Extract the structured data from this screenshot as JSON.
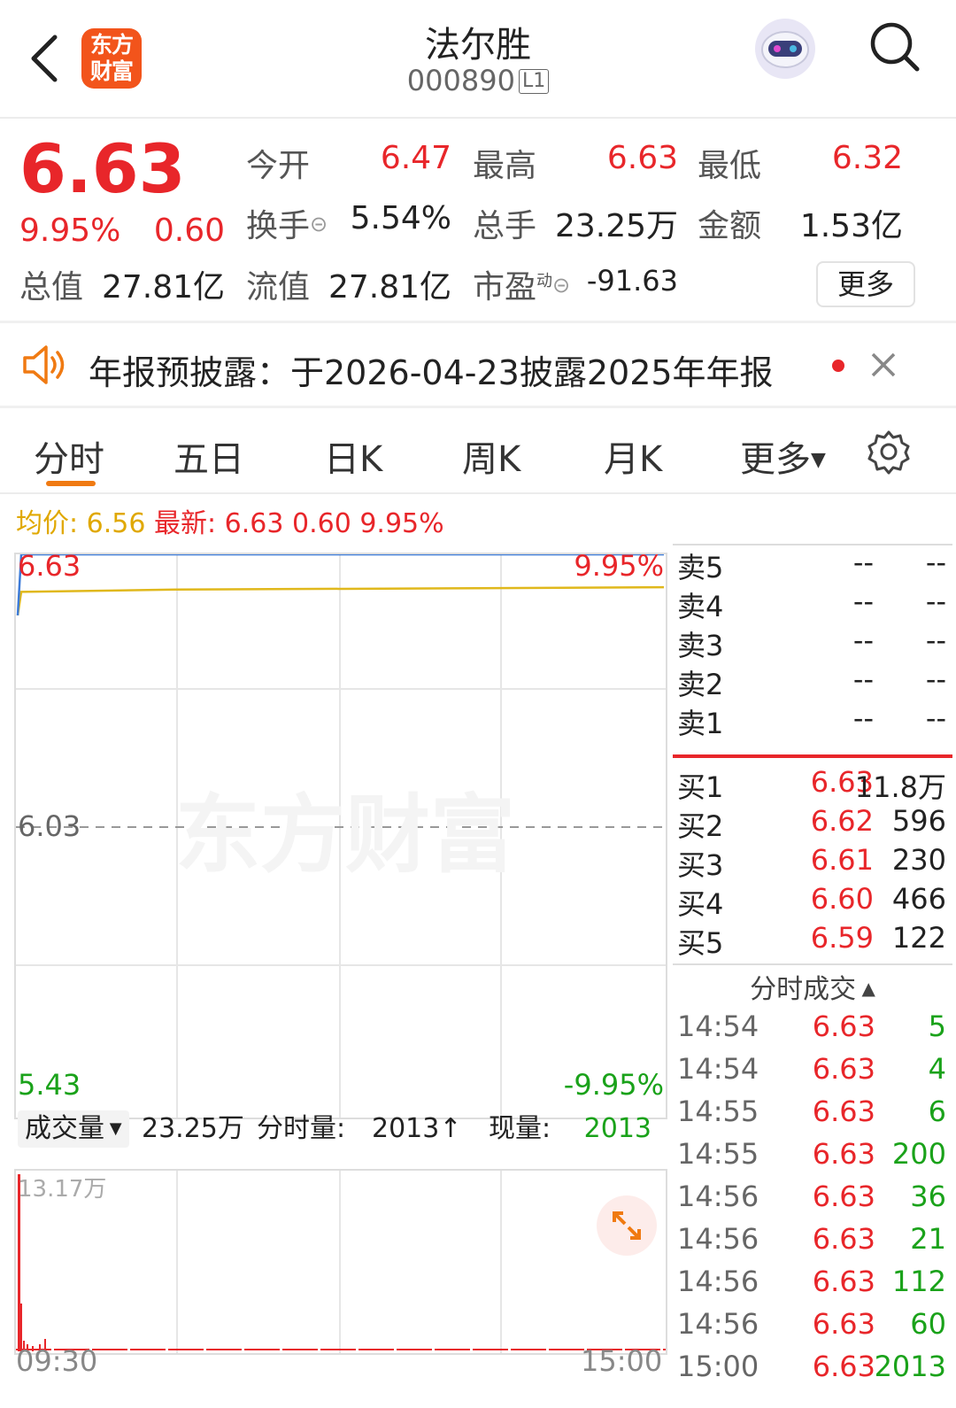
{
  "header": {
    "logo_line1": "东方",
    "logo_line2": "财富",
    "title": "法尔胜",
    "code": "000890",
    "level": "L1"
  },
  "quote": {
    "price": "6.63",
    "change_pct": "9.95%",
    "change": "0.60",
    "open_label": "今开",
    "open": "6.47",
    "high_label": "最高",
    "high": "6.63",
    "low_label": "最低",
    "low": "6.32",
    "turnover_label": "换手",
    "turnover": "5.54%",
    "volume_label": "总手",
    "volume": "23.25万",
    "amount_label": "金额",
    "amount": "1.53亿",
    "mktcap_label": "总值",
    "mktcap": "27.81亿",
    "float_label": "流值",
    "float": "27.81亿",
    "pe_label": "市盈",
    "pe_sup": "动",
    "pe": "-91.63",
    "more": "更多"
  },
  "notice": {
    "text": "年报预披露：于2026-04-23披露2025年年报"
  },
  "tabs": [
    "分时",
    "五日",
    "日K",
    "周K",
    "月K",
    "更多"
  ],
  "legend": {
    "avg_label": "均价:",
    "avg": "6.56",
    "last_label": "最新:",
    "last": "6.63",
    "chg": "0.60",
    "pct": "9.95%"
  },
  "chart": {
    "top_price": "6.63",
    "top_pct": "9.95%",
    "mid_price": "6.03",
    "bottom_price": "5.43",
    "bottom_pct": "-9.95%",
    "watermark": "东方财富",
    "time_start": "09:30",
    "time_end": "15:00"
  },
  "chart_data": {
    "type": "line",
    "ylim": [
      5.43,
      6.63
    ],
    "series": [
      {
        "values": [
          6.5,
          6.63,
          6.63,
          6.63,
          6.63
        ]
      },
      {
        "values": [
          6.5,
          6.55,
          6.555,
          6.558,
          6.56
        ]
      }
    ]
  },
  "volume_bar": {
    "mode": "成交量",
    "total": "23.25万",
    "minute_label": "分时量:",
    "minute": "2013↑",
    "now_label": "现量:",
    "now": "2013",
    "scale": "13.17万"
  },
  "orderbook": {
    "asks": [
      {
        "label": "卖5",
        "price": "--",
        "qty": "--"
      },
      {
        "label": "卖4",
        "price": "--",
        "qty": "--"
      },
      {
        "label": "卖3",
        "price": "--",
        "qty": "--"
      },
      {
        "label": "卖2",
        "price": "--",
        "qty": "--"
      },
      {
        "label": "卖1",
        "price": "--",
        "qty": "--"
      }
    ],
    "bids": [
      {
        "label": "买1",
        "price": "6.63",
        "qty": "11.8万"
      },
      {
        "label": "买2",
        "price": "6.62",
        "qty": "596"
      },
      {
        "label": "买3",
        "price": "6.61",
        "qty": "230"
      },
      {
        "label": "买4",
        "price": "6.60",
        "qty": "466"
      },
      {
        "label": "买5",
        "price": "6.59",
        "qty": "122"
      }
    ]
  },
  "ticks": {
    "header": "分时成交",
    "rows": [
      {
        "time": "14:54",
        "price": "6.63",
        "vol": "5"
      },
      {
        "time": "14:54",
        "price": "6.63",
        "vol": "4"
      },
      {
        "time": "14:55",
        "price": "6.63",
        "vol": "6"
      },
      {
        "time": "14:55",
        "price": "6.63",
        "vol": "200"
      },
      {
        "time": "14:56",
        "price": "6.63",
        "vol": "36"
      },
      {
        "time": "14:56",
        "price": "6.63",
        "vol": "21"
      },
      {
        "time": "14:56",
        "price": "6.63",
        "vol": "112"
      },
      {
        "time": "14:56",
        "price": "6.63",
        "vol": "60"
      },
      {
        "time": "15:00",
        "price": "6.63",
        "vol": "2013"
      }
    ]
  },
  "colors": {
    "up": "#e8262a",
    "down": "#1aa21a",
    "avg": "#e0a800",
    "accent": "#f07a12"
  }
}
